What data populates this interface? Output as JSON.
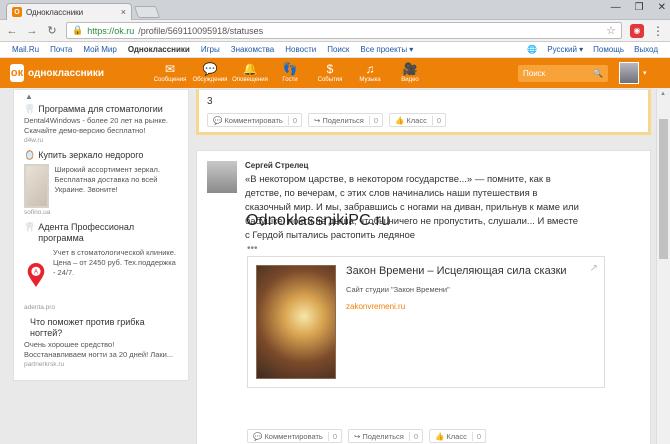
{
  "browser": {
    "tab_title": "Одноклассники",
    "tab_close": "×",
    "window_controls": [
      "—",
      "❐",
      "✕"
    ],
    "nav": {
      "back": "←",
      "forward": "→",
      "reload": "↻"
    },
    "url_host": "https://ok.ru",
    "url_path": "/profile/569110095918/statuses",
    "star": "☆",
    "menu": "⋮"
  },
  "mailbar": {
    "left": [
      "Mail.Ru",
      "Почта",
      "Мой Мир",
      "Одноклассники",
      "Игры",
      "Знакомства",
      "Новости",
      "Поиск",
      "Все проекты ▾"
    ],
    "active_index": 3,
    "language": "Русский ▾",
    "help": "Помощь",
    "logout": "Выход"
  },
  "okheader": {
    "logo_text": "одноклассники",
    "toolbar": [
      {
        "label": "Сообщения",
        "icon": "✉",
        "name": "messages"
      },
      {
        "label": "Обсуждения",
        "icon": "💬",
        "name": "discussions"
      },
      {
        "label": "Оповещения",
        "icon": "🔔",
        "name": "notifications"
      },
      {
        "label": "Гости",
        "icon": "👣",
        "name": "guests"
      },
      {
        "label": "События",
        "icon": "$",
        "name": "events"
      },
      {
        "label": "Музыка",
        "icon": "♫",
        "name": "music"
      },
      {
        "label": "Видео",
        "icon": "🎥",
        "name": "video"
      }
    ],
    "search_placeholder": "Поиск",
    "search_icon": "🔍",
    "avatar_caret": "▾"
  },
  "ads": [
    {
      "title": "Программа для стоматологии",
      "text": "Dental4Windows - более 20 лет на рынке. Скачайте демо-версию бесплатно!",
      "url": "d4w.ru",
      "icon": "🦷"
    },
    {
      "title": "Купить зеркало недорого",
      "text": "Широкий ассортимент зеркал. Бесплатная доставка по всей Украине. Звоните!",
      "url": "sofino.ua",
      "icon": "🪞"
    },
    {
      "title": "Адента Профессионал программа",
      "text": "Учет в стоматологической клинике. Цена – от 2450 руб. Тех.поддержка - 24/7.",
      "url": "adenta.pro",
      "icon": "🦷"
    },
    {
      "title": "Что поможет против грибка ногтей?",
      "text": "Очень хорошее средство! Восстанавливаем ногти за 20 дней! Лаки...",
      "url": "partnerkrsk.ru",
      "icon": ""
    }
  ],
  "post1": {
    "count_text": "3",
    "actions": [
      {
        "label": "Комментировать",
        "count": "0",
        "icon": "💬"
      },
      {
        "label": "Поделиться",
        "count": "0",
        "icon": "↪"
      },
      {
        "label": "Класс",
        "count": "0",
        "icon": "👍"
      }
    ]
  },
  "post2": {
    "author": "Сергей Стрелец",
    "time": "—",
    "text": "«В некотором царстве, в некотором государстве...» — помните, как в детстве, по вечерам, с этих слов начинались наши путешествия в сказочный мир. И мы, забравшись с ногами на диван, прильнув к маме или бабушке, почти не дыша, чтобы ничего не пропустить, слушали... И вместе с Гердой пытались растопить ледяное",
    "more": "•••",
    "link": {
      "title": "Закон Времени – Исцеляющая сила сказки",
      "subtitle": "Сайт студии \"Закон Времени\"",
      "url": "zakonvremeni.ru"
    },
    "actions": [
      {
        "label": "Комментировать",
        "count": "0",
        "icon": "💬"
      },
      {
        "label": "Поделиться",
        "count": "0",
        "icon": "↪"
      },
      {
        "label": "Класс",
        "count": "0",
        "icon": "👍"
      }
    ]
  },
  "watermark": "OdnoklassnikiPC.ru"
}
